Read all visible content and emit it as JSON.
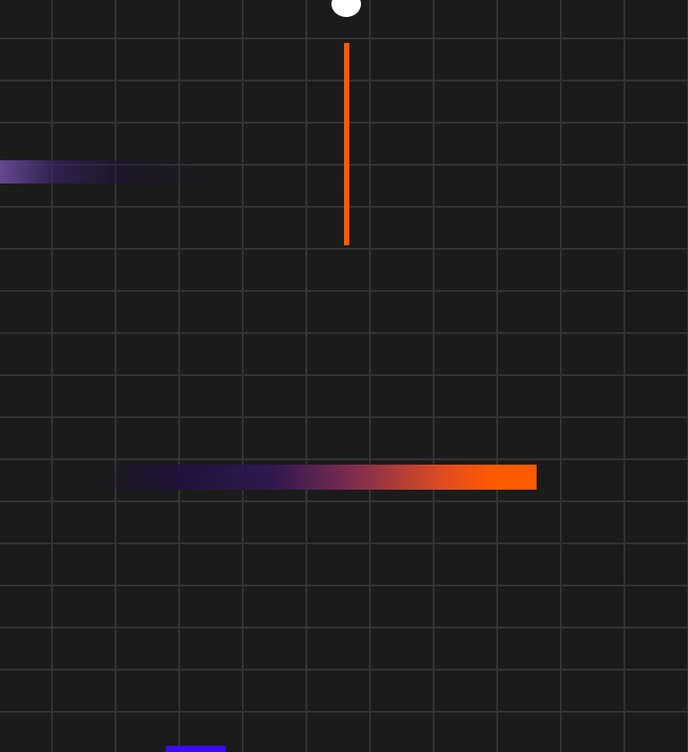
{
  "game": {
    "background_color": "#1b1b1b",
    "grid_color": "#333333",
    "ball_color": "#ffffff",
    "trail_color": "#ff5a00",
    "trail_fade_color": "#5b3f8a",
    "paddle_color": "#3a0bff"
  }
}
